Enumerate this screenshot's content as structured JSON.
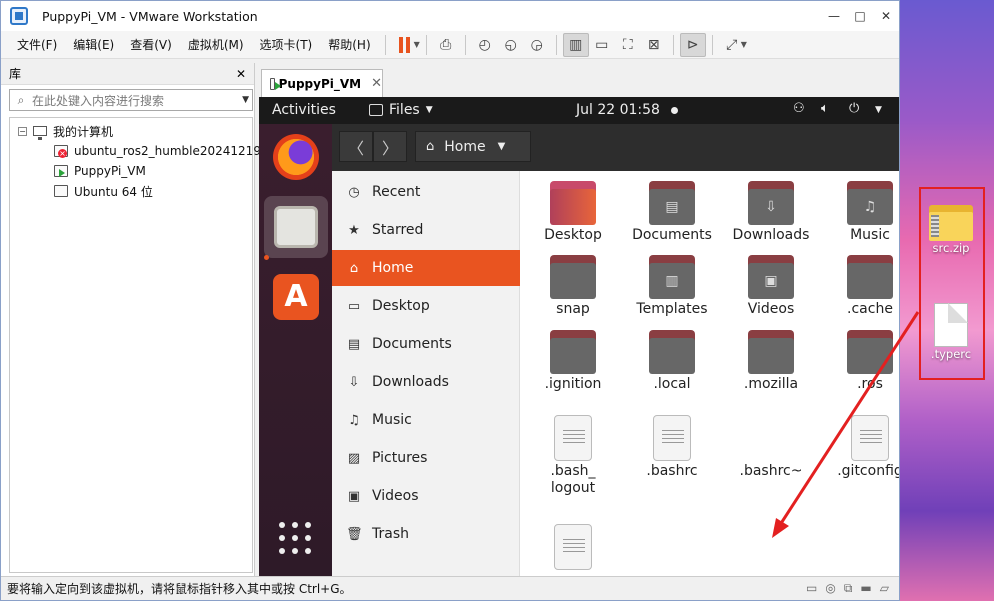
{
  "window": {
    "title": "PuppyPi_VM - VMware Workstation",
    "controls": [
      "—",
      "□",
      "✕"
    ]
  },
  "menu": {
    "items": [
      "文件(F)",
      "编辑(E)",
      "查看(V)",
      "虚拟机(M)",
      "选项卡(T)",
      "帮助(H)"
    ]
  },
  "library": {
    "title": "库",
    "close": "✕",
    "search_placeholder": "在此处键入内容进行搜索",
    "root": "我的计算机",
    "vms": [
      "ubuntu_ros2_humble20241219",
      "PuppyPi_VM",
      "Ubuntu 64 位"
    ]
  },
  "vm_tab": {
    "label": "PuppyPi_VM",
    "close": "✕"
  },
  "ubuntu": {
    "activities": "Activities",
    "app_name": "Files",
    "clock": "Jul 22  01:58",
    "path": "Home",
    "places": [
      "Recent",
      "Starred",
      "Home",
      "Desktop",
      "Documents",
      "Downloads",
      "Music",
      "Pictures",
      "Videos",
      "Trash"
    ],
    "active_place": "Home",
    "files": [
      {
        "name": "Desktop",
        "kind": "folder-desktop",
        "glyph": ""
      },
      {
        "name": "Documents",
        "kind": "folder",
        "glyph": "▤"
      },
      {
        "name": "Downloads",
        "kind": "folder",
        "glyph": "⇩"
      },
      {
        "name": "Music",
        "kind": "folder",
        "glyph": "♫"
      },
      {
        "name": "snap",
        "kind": "folder",
        "glyph": ""
      },
      {
        "name": "Templates",
        "kind": "folder",
        "glyph": "▥"
      },
      {
        "name": "Videos",
        "kind": "folder",
        "glyph": "▣"
      },
      {
        "name": ".cache",
        "kind": "folder",
        "glyph": ""
      },
      {
        "name": ".ignition",
        "kind": "folder",
        "glyph": ""
      },
      {
        "name": ".local",
        "kind": "folder",
        "glyph": ""
      },
      {
        "name": ".mozilla",
        "kind": "folder",
        "glyph": ""
      },
      {
        "name": ".ros",
        "kind": "folder",
        "glyph": ""
      },
      {
        "name": ".bash_\nlogout",
        "kind": "doc",
        "glyph": ""
      },
      {
        "name": ".bashrc",
        "kind": "doc",
        "glyph": ""
      },
      {
        "name": ".bashrc~",
        "kind": "doc-clock",
        "glyph": ""
      },
      {
        "name": ".gitconfig",
        "kind": "doc",
        "glyph": ""
      },
      {
        "name": "",
        "kind": "doc",
        "glyph": ""
      }
    ]
  },
  "status_bar": {
    "text": "要将输入定向到该虚拟机，请将鼠标指针移入其中或按 Ctrl+G。"
  },
  "desktop": {
    "icons": [
      "src.zip",
      ".typerc"
    ],
    "annotation_color": "#e32020"
  },
  "colors": {
    "ubuntu_accent": "#e95420",
    "vmware_pause": "#e8531e"
  }
}
